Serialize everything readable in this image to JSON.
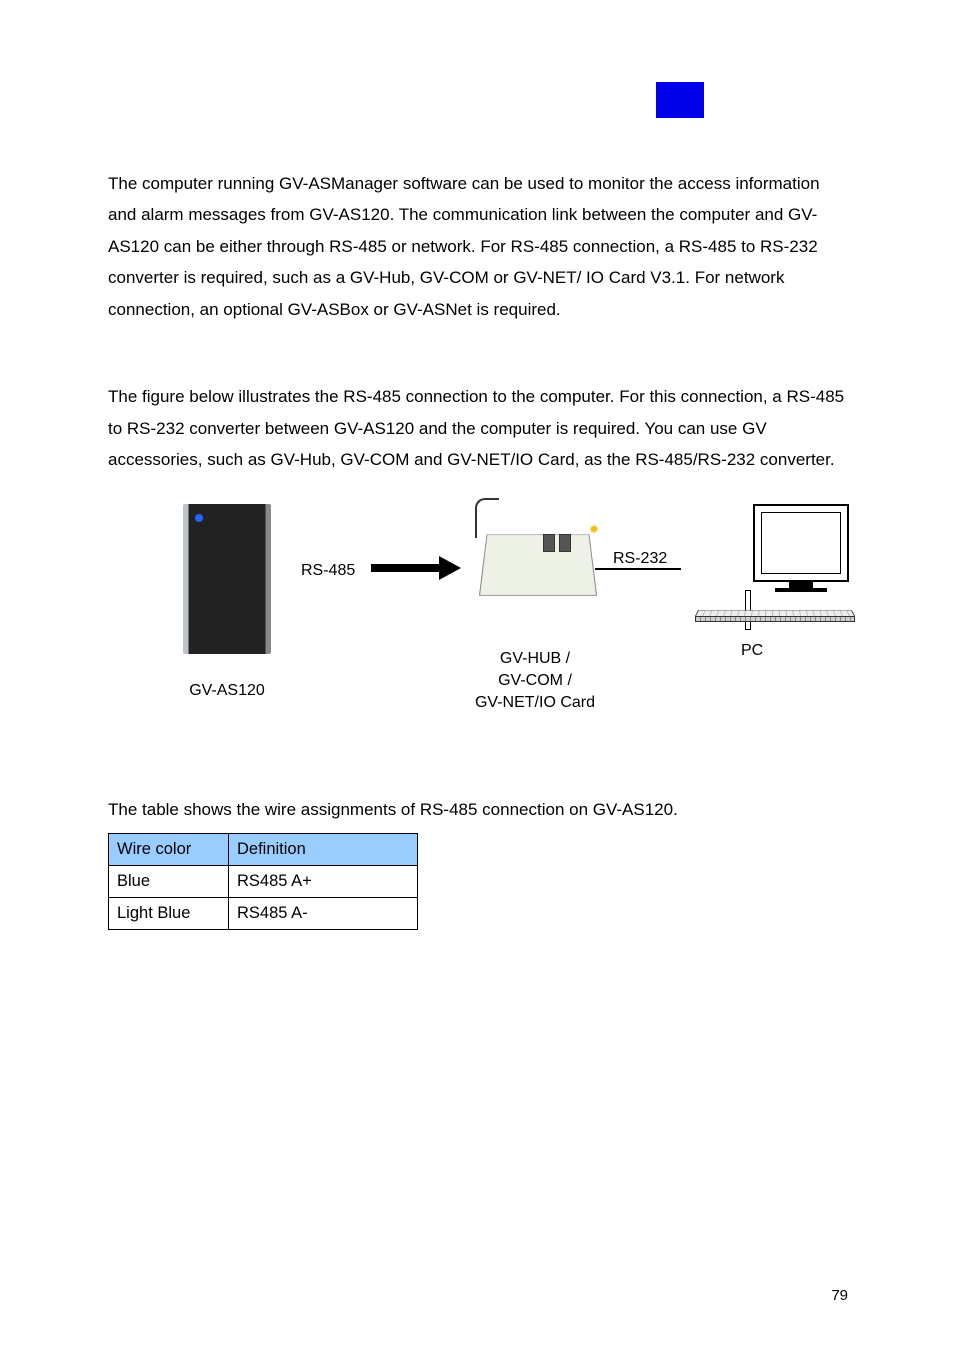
{
  "chapter_bg": "#0000e8",
  "para1": "The computer running GV-ASManager software can be used to monitor the access information and alarm messages from GV-AS120. The communication link between the computer and GV-AS120 can be either through RS-485 or network. For RS-485 connection, a RS-485 to RS-232 converter is required, such as a GV-Hub, GV-COM or GV-NET/ IO Card V3.1. For network connection, an optional GV-ASBox or GV-ASNet is required.",
  "para2": "The figure below illustrates the RS-485 connection to the computer. For this connection, a RS-485 to RS-232 converter between GV-AS120 and the computer is required. You can use GV accessories, such as GV-Hub, GV-COM and GV-NET/IO Card, as the RS-485/RS-232 converter.",
  "diagram": {
    "device_label": "GV-AS120",
    "rs485_label": "RS-485",
    "hub_label_l1": "GV-HUB /",
    "hub_label_l2": "GV-COM /",
    "hub_label_l3": "GV-NET/IO Card",
    "rs232_label": "RS-232",
    "pc_label": "PC"
  },
  "table_caption": "The table shows the wire assignments of RS-485 connection on GV-AS120.",
  "table": {
    "headers": [
      "Wire color",
      "Definition"
    ],
    "rows": [
      [
        "Blue",
        "RS485 A+"
      ],
      [
        "Light Blue",
        "RS485 A-"
      ]
    ]
  },
  "page_number": "79"
}
